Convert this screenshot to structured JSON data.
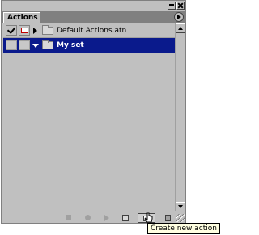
{
  "panel": {
    "tab_label": "Actions",
    "window_buttons": {
      "minimize_icon": "minimize-icon",
      "close_icon": "close-icon"
    },
    "menu_icon": "panel-menu-arrow-icon"
  },
  "actions": [
    {
      "label": "Default Actions.atn",
      "checked": true,
      "dialog_toggle": true,
      "expanded": false,
      "selected": false
    },
    {
      "label": "My set",
      "checked": false,
      "dialog_toggle": false,
      "expanded": true,
      "selected": true
    }
  ],
  "toolbar": {
    "buttons": [
      {
        "icon": "stop-icon"
      },
      {
        "icon": "record-icon"
      },
      {
        "icon": "play-icon"
      },
      {
        "icon": "new-set-icon"
      },
      {
        "icon": "new-action-icon"
      },
      {
        "icon": "trash-icon"
      }
    ]
  },
  "tooltip": {
    "text": "Create new action"
  },
  "colors": {
    "selection": "#0a1a8c",
    "tooltip_bg": "#ffffe1",
    "panel_bg": "#c0c0c0"
  }
}
